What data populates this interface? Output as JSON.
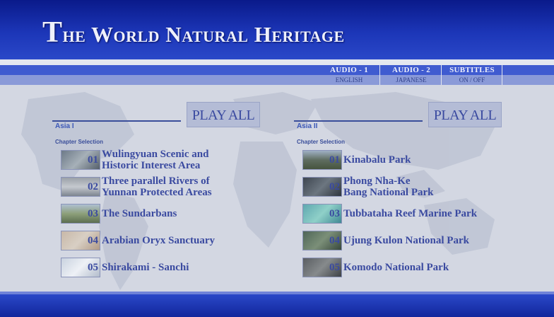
{
  "title": {
    "first_letter": "T",
    "rest": "he World Natural Heritage"
  },
  "options": [
    {
      "label": "AUDIO - 1",
      "value": "ENGLISH"
    },
    {
      "label": "AUDIO - 2",
      "value": "JAPANESE"
    },
    {
      "label": "SUBTITLES",
      "value": "ON  /  OFF"
    }
  ],
  "play_all_label": "PLAY ALL",
  "chapter_selection_label": "Chapter Selection",
  "panels": [
    {
      "label": "Asia I",
      "items": [
        {
          "num": "01",
          "name": "Wulingyuan Scenic and\nHistoric Interest Area"
        },
        {
          "num": "02",
          "name": "Three parallel Rivers of\nYunnan Protected Areas"
        },
        {
          "num": "03",
          "name": "The Sundarbans"
        },
        {
          "num": "04",
          "name": "Arabian Oryx Sanctuary"
        },
        {
          "num": "05",
          "name": "Shirakami - Sanchi"
        }
      ]
    },
    {
      "label": "Asia II",
      "items": [
        {
          "num": "01",
          "name": "Kinabalu Park"
        },
        {
          "num": "02",
          "name": "Phong Nha-Ke\nBang National Park"
        },
        {
          "num": "03",
          "name": "Tubbataha Reef Marine Park"
        },
        {
          "num": "04",
          "name": "Ujung Kulon National Park"
        },
        {
          "num": "05",
          "name": "Komodo National Park"
        }
      ]
    }
  ],
  "colors": {
    "header": "#1c36b8",
    "accent": "#3a4aa0",
    "background": "#d3d7e2"
  }
}
